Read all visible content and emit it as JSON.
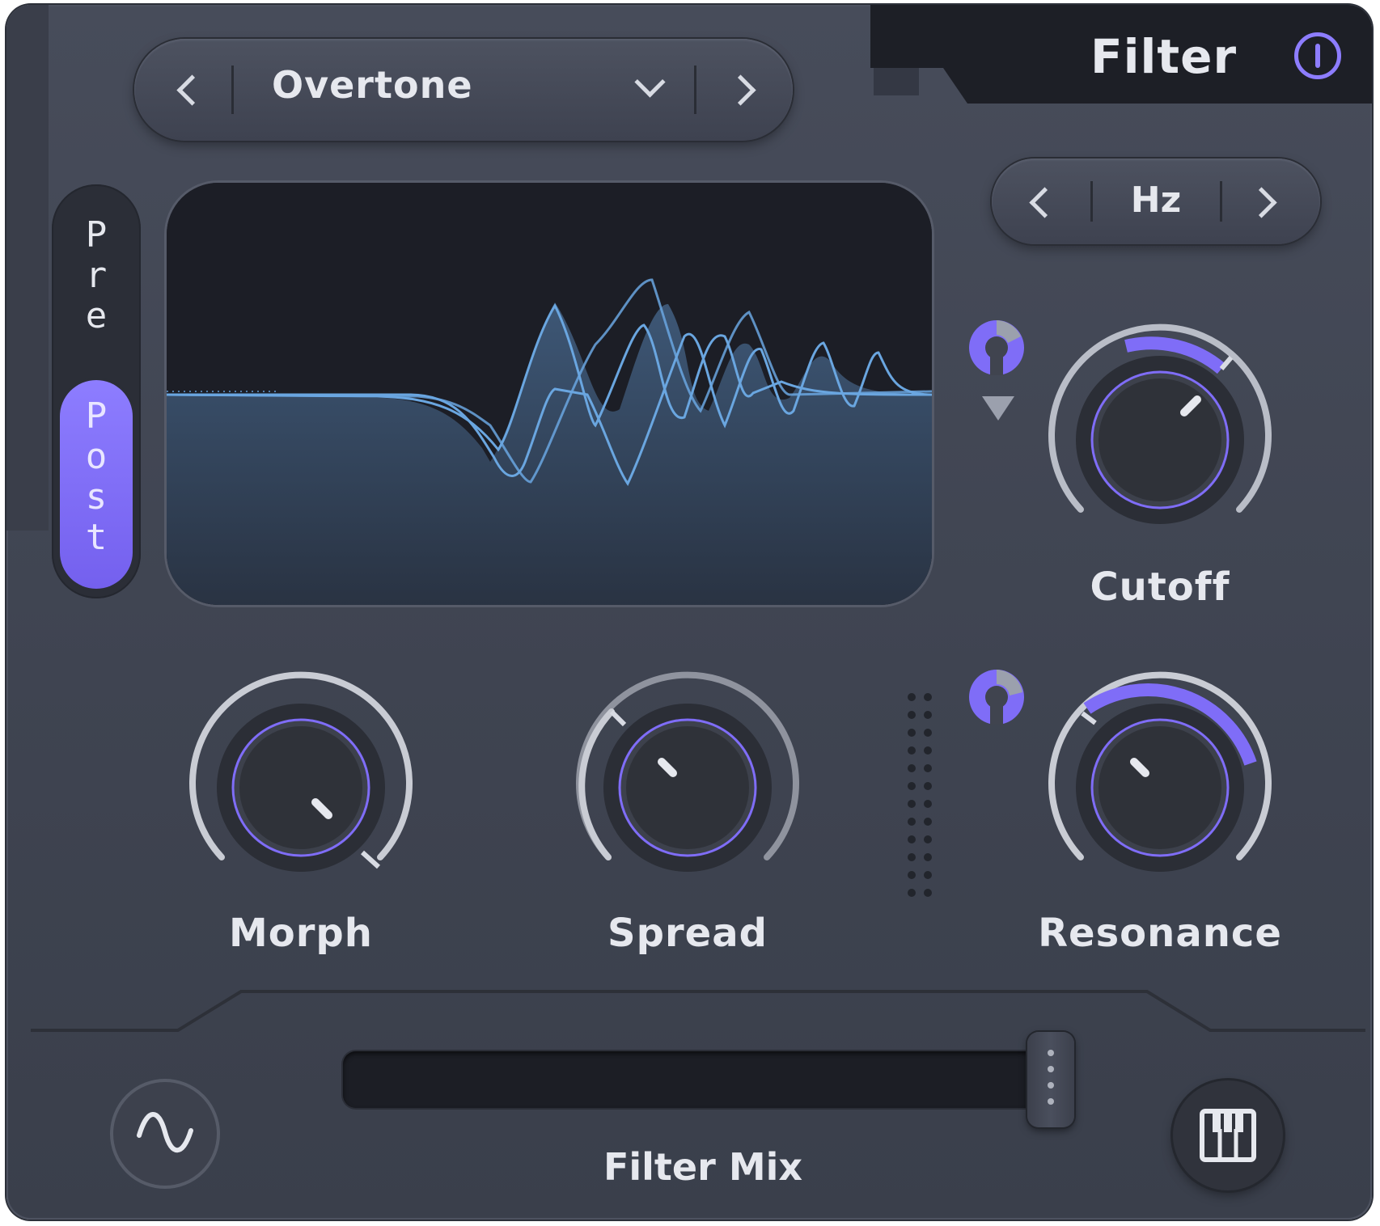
{
  "module": {
    "title": "Filter",
    "power_icon": "power-icon",
    "accent_color": "#8d7dff"
  },
  "preset": {
    "name": "Overtone"
  },
  "unit": {
    "name": "Hz"
  },
  "routing": {
    "pre_label": "Pre",
    "post_label": "Post",
    "selected": "Post"
  },
  "knobs": {
    "cutoff": {
      "label": "Cutoff"
    },
    "morph": {
      "label": "Morph"
    },
    "spread": {
      "label": "Spread"
    },
    "resonance": {
      "label": "Resonance"
    }
  },
  "filter_mix": {
    "label": "Filter Mix",
    "value": 0.98
  },
  "icons": {
    "lfo": "sine-wave-icon",
    "keyboard": "piano-keys-icon"
  }
}
